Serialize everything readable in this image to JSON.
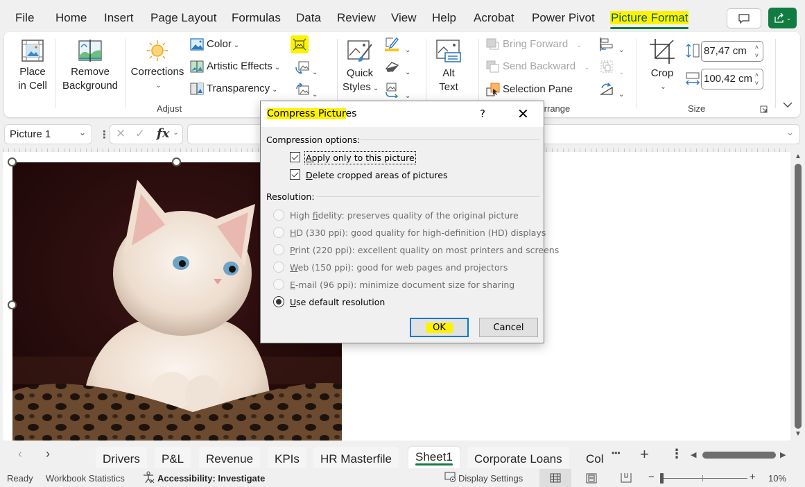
{
  "menu": {
    "tabs": [
      "File",
      "Home",
      "Insert",
      "Page Layout",
      "Formulas",
      "Data",
      "Review",
      "View",
      "Help",
      "Acrobat",
      "Power Pivot",
      "Picture Format"
    ],
    "active_tab": "Picture Format"
  },
  "ribbon": {
    "place_in_cell": [
      "Place",
      "in Cell"
    ],
    "remove_background": [
      "Remove",
      "Background"
    ],
    "corrections": "Corrections",
    "color": "Color",
    "artistic_effects": "Artistic Effects",
    "transparency": "Transparency",
    "adjust_label": "Adjust",
    "quick_styles": [
      "Quick",
      "Styles"
    ],
    "alt_text": [
      "Alt",
      "Text"
    ],
    "bring_forward": "Bring Forward",
    "send_backward": "Send Backward",
    "selection_pane": "Selection Pane",
    "arrange_label": "Arrange",
    "crop": "Crop",
    "height_value": "87,47 cm",
    "width_value": "100,42 cm",
    "size_label": "Size",
    "highlight_color": "#fff200",
    "accent_color": "#107c41"
  },
  "formula_bar": {
    "name_box": "Picture 1",
    "fx": "fx",
    "formula": ""
  },
  "dialog": {
    "title_highlighted": "Compress Pictur",
    "title_rest": "es",
    "help": "?",
    "compression_options_label": "Compression options:",
    "checkboxes": [
      {
        "mnemonic": "A",
        "rest": "pply only to this picture",
        "checked": true
      },
      {
        "mnemonic": "D",
        "rest": "elete cropped areas of pictures",
        "checked": true
      }
    ],
    "resolution_label": "Resolution:",
    "radios": [
      {
        "pre": "High ",
        "mnemonic": "f",
        "rest": "idelity: preserves quality of the original picture",
        "selected": false,
        "enabled": false
      },
      {
        "pre": "",
        "mnemonic": "H",
        "rest": "D (330 ppi): good quality for high-definition (HD) displays",
        "selected": false,
        "enabled": false
      },
      {
        "pre": "",
        "mnemonic": "P",
        "rest": "rint (220 ppi): excellent quality on most printers and screens",
        "selected": false,
        "enabled": false
      },
      {
        "pre": "",
        "mnemonic": "W",
        "rest": "eb (150 ppi): good for web pages and projectors",
        "selected": false,
        "enabled": false
      },
      {
        "pre": "",
        "mnemonic": "E",
        "rest": "-mail (96 ppi): minimize document size for sharing",
        "selected": false,
        "enabled": false
      },
      {
        "pre": "",
        "mnemonic": "U",
        "rest": "se default resolution",
        "selected": true,
        "enabled": true
      }
    ],
    "ok_label": "OK",
    "cancel_label": "Cancel"
  },
  "sheet_tabs": {
    "tabs": [
      "Drivers",
      "P&L",
      "Revenue",
      "KPIs",
      "HR Masterfile",
      "Sheet1",
      "Corporate Loans",
      "Col"
    ],
    "active": "Sheet1",
    "more": "•••",
    "add": "+",
    "options": "⋮"
  },
  "status_bar": {
    "ready": "Ready",
    "workbook_statistics": "Workbook Statistics",
    "accessibility": "Accessibility: Investigate",
    "display_settings": "Display Settings",
    "zoom_minus": "−",
    "zoom_plus": "+",
    "zoom_percent": "10%",
    "zoom_value": 10
  }
}
